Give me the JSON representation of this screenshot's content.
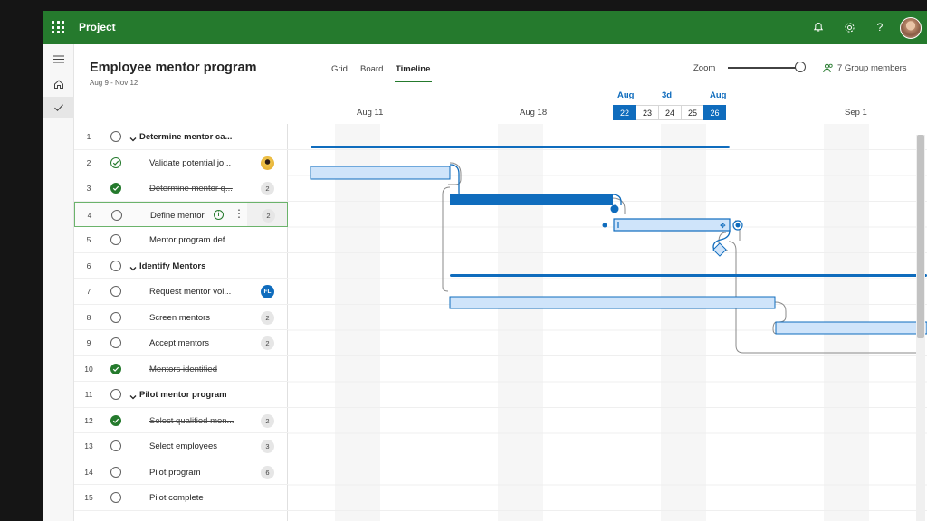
{
  "app": {
    "title": "Project"
  },
  "project": {
    "title": "Employee mentor program",
    "dates": "Aug 9 - Nov 12"
  },
  "views": [
    {
      "label": "Grid",
      "active": false
    },
    {
      "label": "Board",
      "active": false
    },
    {
      "label": "Timeline",
      "active": true
    }
  ],
  "zoom": {
    "label": "Zoom",
    "level": 1.0
  },
  "members": {
    "label": "7 Group members"
  },
  "timeline": {
    "date_labels": [
      "Aug 11",
      "Aug 18",
      "Sep 1"
    ],
    "zoom_months": [
      "Aug",
      "3d",
      "Aug"
    ],
    "days": [
      {
        "label": "22",
        "selected": true
      },
      {
        "label": "23",
        "selected": false
      },
      {
        "label": "24",
        "selected": false
      },
      {
        "label": "25",
        "selected": false
      },
      {
        "label": "26",
        "selected": true
      }
    ]
  },
  "tasks": [
    {
      "num": "1",
      "name": "Determine mentor ca...",
      "summary": true,
      "status": "open",
      "struck": false,
      "badge": ""
    },
    {
      "num": "2",
      "name": "Validate potential jo...",
      "summary": false,
      "status": "partial",
      "struck": false,
      "badge": "photo"
    },
    {
      "num": "3",
      "name": "Determine mentor q...",
      "summary": false,
      "status": "done",
      "struck": true,
      "badge": "2"
    },
    {
      "num": "4",
      "name": "Define mentor",
      "summary": false,
      "status": "open",
      "struck": false,
      "badge": "2",
      "focused": true
    },
    {
      "num": "5",
      "name": "Mentor program def...",
      "summary": false,
      "status": "open",
      "struck": false,
      "badge": ""
    },
    {
      "num": "6",
      "name": "Identify Mentors",
      "summary": true,
      "status": "open",
      "struck": false,
      "badge": ""
    },
    {
      "num": "7",
      "name": "Request mentor vol...",
      "summary": false,
      "status": "open",
      "struck": false,
      "badge": "FL"
    },
    {
      "num": "8",
      "name": "Screen mentors",
      "summary": false,
      "status": "open",
      "struck": false,
      "badge": "2"
    },
    {
      "num": "9",
      "name": "Accept mentors",
      "summary": false,
      "status": "open",
      "struck": false,
      "badge": "2"
    },
    {
      "num": "10",
      "name": "Mentors identified",
      "summary": false,
      "status": "done",
      "struck": true,
      "badge": ""
    },
    {
      "num": "11",
      "name": "Pilot mentor program",
      "summary": true,
      "status": "open",
      "struck": false,
      "badge": ""
    },
    {
      "num": "12",
      "name": "Select qualified men...",
      "summary": false,
      "status": "done",
      "struck": true,
      "badge": "2"
    },
    {
      "num": "13",
      "name": "Select employees",
      "summary": false,
      "status": "open",
      "struck": false,
      "badge": "3"
    },
    {
      "num": "14",
      "name": "Pilot program",
      "summary": false,
      "status": "open",
      "struck": false,
      "badge": "6"
    },
    {
      "num": "15",
      "name": "Pilot complete",
      "summary": false,
      "status": "open",
      "struck": false,
      "badge": ""
    }
  ],
  "colors": {
    "brand": "#257a2d",
    "accent": "#0f6cbd",
    "bar_fill": "#cfe4fa",
    "bar_solid": "#0f6cbd"
  },
  "icons": {
    "bell": "bell-icon",
    "settings": "gear-icon",
    "help": "help-icon",
    "members": "people-icon"
  }
}
